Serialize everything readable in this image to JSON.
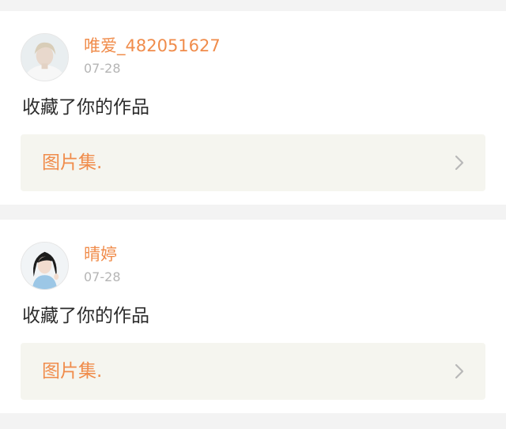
{
  "notifications": [
    {
      "username": "唯爱_482051627",
      "date": "07-28",
      "action": "收藏了你的作品",
      "link_label": "图片集.",
      "avatar_icon": "user-avatar-photo",
      "link_icon": "chevron-right-icon"
    },
    {
      "username": "晴婷",
      "date": "07-28",
      "action": "收藏了你的作品",
      "link_label": "图片集.",
      "avatar_icon": "user-avatar-photo",
      "link_icon": "chevron-right-icon"
    }
  ],
  "colors": {
    "page_background": "#f3f3f3",
    "card_background": "#ffffff",
    "accent": "#f08c4b",
    "date_text": "#b5b5b5",
    "body_text": "#2b2b2b",
    "link_background": "#f5f5ef",
    "chevron": "#b8b8b8"
  }
}
